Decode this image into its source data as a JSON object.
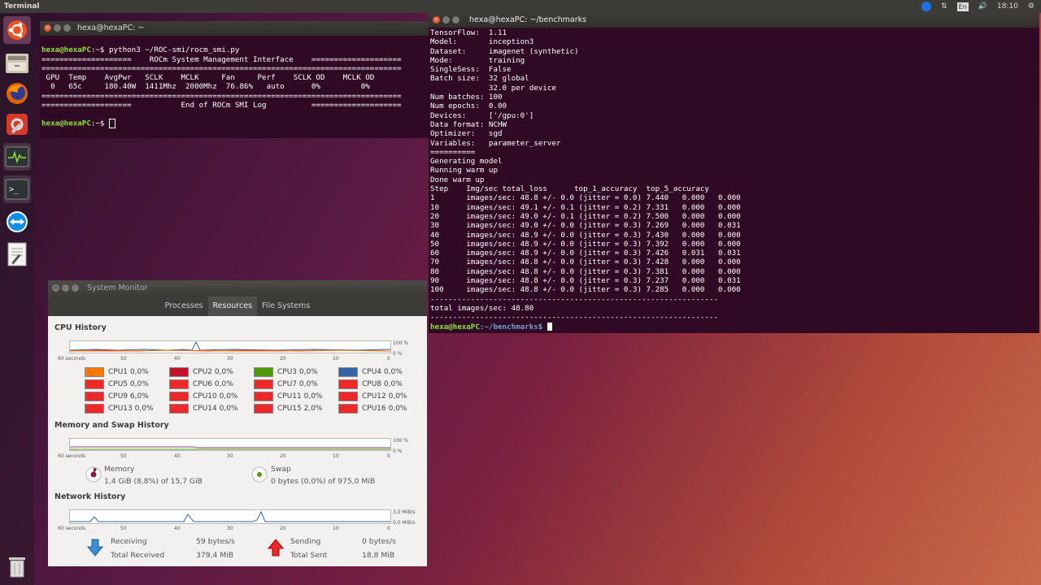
{
  "topbar": {
    "title": "Terminal",
    "lang": "En",
    "time": "18:10"
  },
  "launcher": {
    "items": [
      "ubuntu-icon",
      "files-icon",
      "firefox-icon",
      "settings-icon",
      "system-monitor-icon",
      "terminal-icon",
      "teamviewer-icon",
      "text-editor-icon",
      "trash-icon"
    ]
  },
  "term1": {
    "title": "hexa@hexaPC: ~",
    "prompt_user": "hexa@hexaPC",
    "prompt_path": ":~$",
    "command": " python3 ~/ROC-smi/rocm_smi.py",
    "lines": [
      "",
      "====================    ROCm System Management Interface    ====================",
      "================================================================================",
      " GPU  Temp    AvgPwr   SCLK    MCLK     Fan     Perf    SCLK OD    MCLK OD",
      "  0   65c     180.40W  1411Mhz  2000Mhz  76.86%   auto      0%         0%",
      "================================================================================",
      "====================           End of ROCm SMI Log          ===================="
    ]
  },
  "term2": {
    "title": "hexa@hexaPC: ~/benchmarks",
    "lines": [
      "TensorFlow:  1.11",
      "Model:       inception3",
      "Dataset:     imagenet (synthetic)",
      "Mode:        training",
      "SingleSess:  False",
      "Batch size:  32 global",
      "             32.0 per device",
      "Num batches: 100",
      "Num epochs:  0.00",
      "Devices:     ['/gpu:0']",
      "Data format: NCHW",
      "Optimizer:   sgd",
      "Variables:   parameter_server",
      "==========",
      "Generating model",
      "Running warm up",
      "Done warm up",
      "Step    Img/sec total_loss      top_1_accuracy  top_5_accuracy",
      "1       images/sec: 48.8 +/- 0.0 (jitter = 0.0) 7.440   0.000   0.000",
      "10      images/sec: 49.1 +/- 0.1 (jitter = 0.2) 7.331   0.000   0.000",
      "20      images/sec: 49.0 +/- 0.1 (jitter = 0.2) 7.500   0.000   0.000",
      "30      images/sec: 49.0 +/- 0.0 (jitter = 0.3) 7.269   0.000   0.031",
      "40      images/sec: 48.9 +/- 0.0 (jitter = 0.3) 7.430   0.000   0.000",
      "50      images/sec: 48.9 +/- 0.0 (jitter = 0.3) 7.392   0.000   0.000",
      "60      images/sec: 48.9 +/- 0.0 (jitter = 0.3) 7.426   0.031   0.031",
      "70      images/sec: 48.8 +/- 0.0 (jitter = 0.3) 7.428   0.000   0.000",
      "80      images/sec: 48.8 +/- 0.0 (jitter = 0.3) 7.381   0.000   0.000",
      "90      images/sec: 48.8 +/- 0.0 (jitter = 0.3) 7.237   0.000   0.031",
      "100     images/sec: 48.8 +/- 0.0 (jitter = 0.3) 7.285   0.000   0.000",
      "----------------------------------------------------------------",
      "total images/sec: 48.80",
      "----------------------------------------------------------------"
    ],
    "prompt_user": "hexa@hexaPC",
    "prompt_path": ":~/benchmarks$"
  },
  "sysmon": {
    "title": "System Monitor",
    "tabs": [
      "Processes",
      "Resources",
      "File Systems"
    ],
    "cpu_title": "CPU History",
    "mem_title": "Memory and Swap History",
    "net_title": "Network History",
    "time_axis": [
      "60 seconds",
      "50",
      "40",
      "30",
      "20",
      "10",
      "0"
    ],
    "pct_hi": "100 %",
    "pct_lo": "0 %",
    "net_hi": "3,0 MiB/s",
    "net_lo": "0,0 MiB/s",
    "cpus": [
      {
        "label": "CPU1 0,0%",
        "color": "#f57900"
      },
      {
        "label": "CPU2 0,0%",
        "color": "#c4122a"
      },
      {
        "label": "CPU3 0,0%",
        "color": "#4e9a06"
      },
      {
        "label": "CPU4 0,0%",
        "color": "#3465a4"
      },
      {
        "label": "CPU5 0,0%",
        "color": "#ef2929"
      },
      {
        "label": "CPU6 0,0%",
        "color": "#ef2929"
      },
      {
        "label": "CPU7 0,0%",
        "color": "#ef2929"
      },
      {
        "label": "CPU8 0,0%",
        "color": "#ef2929"
      },
      {
        "label": "CPU9 6,0%",
        "color": "#ef2929"
      },
      {
        "label": "CPU10 0,0%",
        "color": "#ef2929"
      },
      {
        "label": "CPU11 0,0%",
        "color": "#ef2929"
      },
      {
        "label": "CPU12 0,0%",
        "color": "#ef2929"
      },
      {
        "label": "CPU13 0,0%",
        "color": "#ef2929"
      },
      {
        "label": "CPU14 0,0%",
        "color": "#ef2929"
      },
      {
        "label": "CPU15 2,0%",
        "color": "#ef2929"
      },
      {
        "label": "CPU16 0,0%",
        "color": "#ef2929"
      }
    ],
    "memory": {
      "label": "Memory",
      "value": "1,4 GiB (8,8%) of 15,7 GiB"
    },
    "swap": {
      "label": "Swap",
      "value": "0 bytes (0,0%) of 975,0 MiB"
    },
    "receiving": {
      "label": "Receiving",
      "rate": "59 bytes/s",
      "total_label": "Total Received",
      "total": "379,4 MiB"
    },
    "sending": {
      "label": "Sending",
      "rate": "0 bytes/s",
      "total_label": "Total Sent",
      "total": "18,8 MiB"
    }
  }
}
